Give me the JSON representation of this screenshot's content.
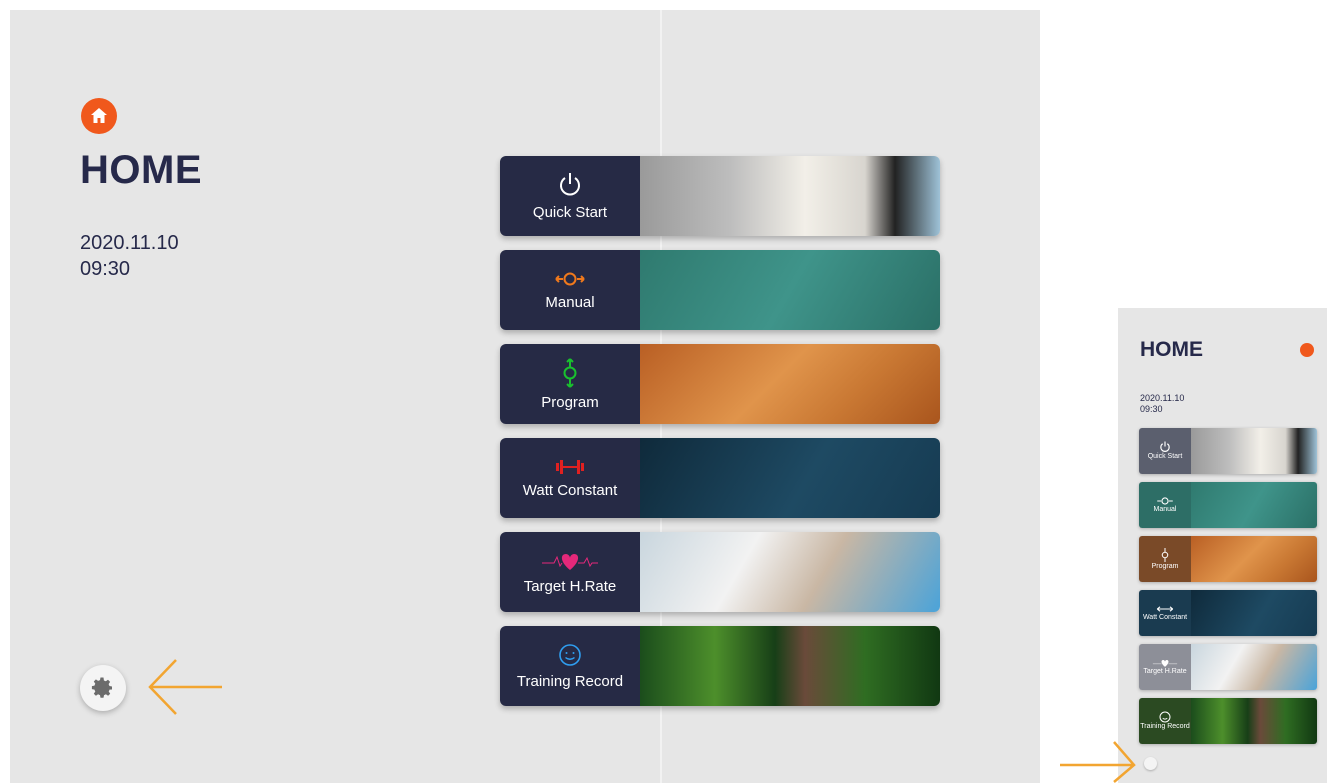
{
  "app": {
    "title": "HOME",
    "date": "2020.11.10",
    "time": "09:30"
  },
  "colors": {
    "accent": "#f0581c",
    "navy": "#262a45",
    "annotation_arrow": "#f2a531"
  },
  "menu": [
    {
      "label": "Quick Start",
      "icon": "power-icon",
      "icon_color": "#ffffff"
    },
    {
      "label": "Manual",
      "icon": "manual-icon",
      "icon_color": "#f0791c"
    },
    {
      "label": "Program",
      "icon": "program-icon",
      "icon_color": "#19c12e"
    },
    {
      "label": "Watt Constant",
      "icon": "dumbbell-icon",
      "icon_color": "#e02020"
    },
    {
      "label": "Target H.Rate",
      "icon": "heart-rate-icon",
      "icon_color": "#e5287a"
    },
    {
      "label": "Training Record",
      "icon": "smiley-icon",
      "icon_color": "#2f9ef0"
    }
  ],
  "mini": {
    "title": "HOME",
    "date": "2020.11.10",
    "time": "09:30",
    "menu": [
      {
        "label": "Quick Start"
      },
      {
        "label": "Manual"
      },
      {
        "label": "Program"
      },
      {
        "label": "Watt Constant"
      },
      {
        "label": "Target H.Rate"
      },
      {
        "label": "Training Record"
      }
    ]
  },
  "settings": {
    "icon": "gear-icon"
  }
}
